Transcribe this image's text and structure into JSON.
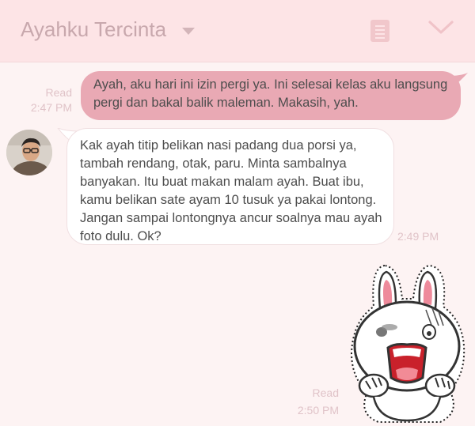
{
  "header": {
    "title": "Ayahku Tercinta",
    "title_dropdown_icon": "caret-down-icon",
    "notes_icon": "notes-icon",
    "collapse_icon": "chevron-down-icon"
  },
  "messages": [
    {
      "direction": "outgoing",
      "text": "Ayah, aku hari ini izin pergi ya. Ini selesai kelas aku langsung pergi dan bakal balik maleman. Makasih, yah.",
      "status": "Read",
      "time": "2:47 PM"
    },
    {
      "direction": "incoming",
      "avatar": "avatar",
      "text": "Kak ayah titip belikan nasi padang dua porsi ya, tambah rendang, otak, paru. Minta sambalnya banyakan. Itu buat makan malam ayah. Buat ibu, kamu belikan sate ayam 10 tusuk ya pakai lontong. Jangan sampai lontongnya ancur soalnya mau ayah foto dulu. Ok?",
      "time": "2:49 PM"
    },
    {
      "direction": "outgoing",
      "type": "sticker",
      "sticker": "shocked-bunny-sticker",
      "status": "Read",
      "time": "2:50 PM"
    }
  ],
  "colors": {
    "header_bg": "#fde4e6",
    "outgoing_bubble": "#e9a9b4",
    "incoming_bubble": "#ffffff",
    "chat_bg": "#fdf3f3",
    "meta_text": "#e0c3c8"
  }
}
